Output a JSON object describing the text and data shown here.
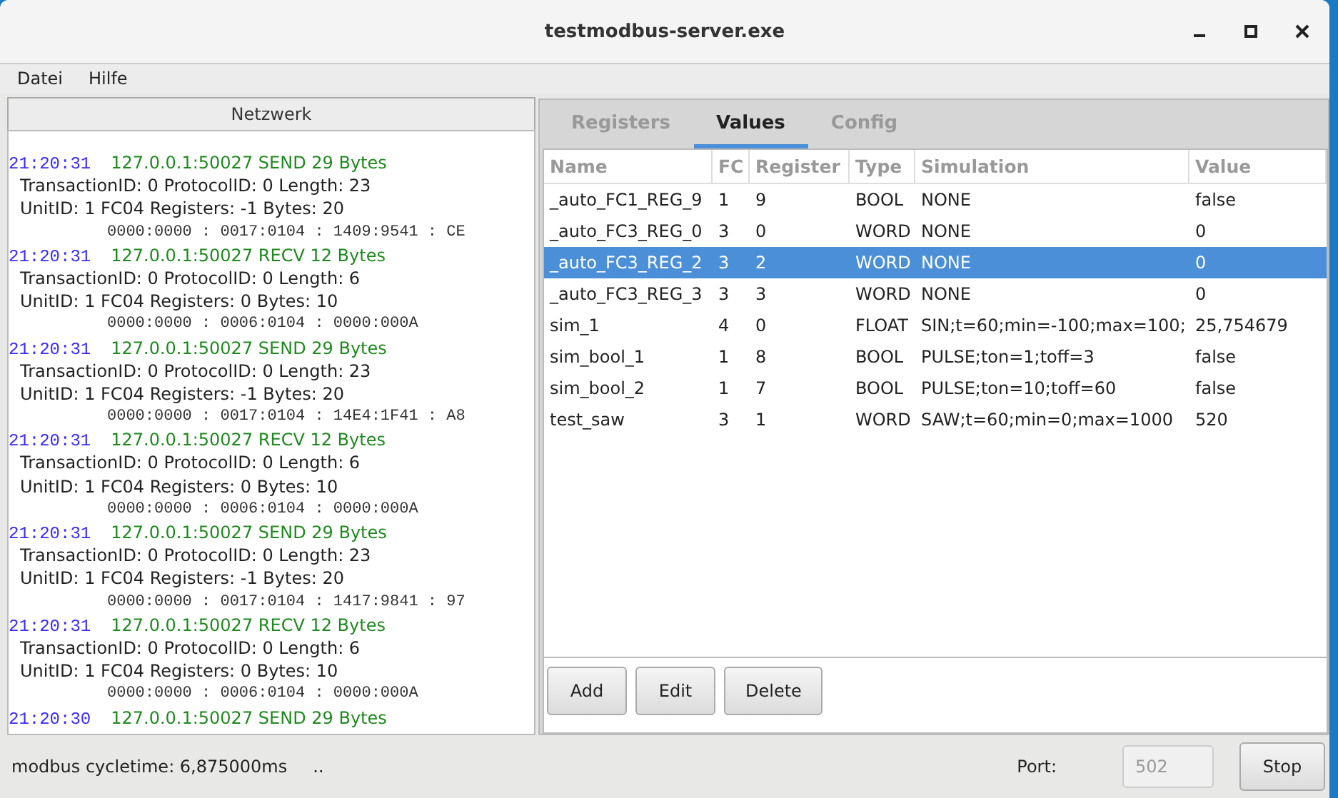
{
  "window": {
    "title": "testmodbus-server.exe"
  },
  "menu": [
    "Datei",
    "Hilfe"
  ],
  "network": {
    "title": "Netzwerk",
    "entries": [
      {
        "time": "21:20:31",
        "header": "127.0.0.1:50027 SEND 29 Bytes",
        "details": [
          "TransactionID: 0  ProtocolID: 0  Length: 23",
          "UnitID: 1  FC04 Registers: -1 Bytes: 20"
        ],
        "hex": "0000:0000 : 0017:0104 : 1409:9541 : CE"
      },
      {
        "time": "21:20:31",
        "header": "127.0.0.1:50027 RECV 12 Bytes",
        "details": [
          "TransactionID: 0  ProtocolID: 0  Length: 6",
          "UnitID: 1  FC04 Registers: 0 Bytes: 10"
        ],
        "hex": "0000:0000 : 0006:0104 : 0000:000A"
      },
      {
        "time": "21:20:31",
        "header": "127.0.0.1:50027 SEND 29 Bytes",
        "details": [
          "TransactionID: 0  ProtocolID: 0  Length: 23",
          "UnitID: 1  FC04 Registers: -1 Bytes: 20"
        ],
        "hex": "0000:0000 : 0017:0104 : 14E4:1F41 : A8"
      },
      {
        "time": "21:20:31",
        "header": "127.0.0.1:50027 RECV 12 Bytes",
        "details": [
          "TransactionID: 0  ProtocolID: 0  Length: 6",
          "UnitID: 1  FC04 Registers: 0 Bytes: 10"
        ],
        "hex": "0000:0000 : 0006:0104 : 0000:000A"
      },
      {
        "time": "21:20:31",
        "header": "127.0.0.1:50027 SEND 29 Bytes",
        "details": [
          "TransactionID: 0  ProtocolID: 0  Length: 23",
          "UnitID: 1  FC04 Registers: -1 Bytes: 20"
        ],
        "hex": "0000:0000 : 0017:0104 : 1417:9841 : 97"
      },
      {
        "time": "21:20:31",
        "header": "127.0.0.1:50027 RECV 12 Bytes",
        "details": [
          "TransactionID: 0  ProtocolID: 0  Length: 6",
          "UnitID: 1  FC04 Registers: 0 Bytes: 10"
        ],
        "hex": "0000:0000 : 0006:0104 : 0000:000A"
      },
      {
        "time": "21:20:30",
        "header": "127.0.0.1:50027 SEND 29 Bytes"
      }
    ]
  },
  "tabs": [
    {
      "label": "Registers",
      "selected": false
    },
    {
      "label": "Values",
      "selected": true
    },
    {
      "label": "Config",
      "selected": false
    }
  ],
  "table": {
    "columns": [
      "Name",
      "FC",
      "Register",
      "Type",
      "Simulation",
      "Value"
    ],
    "rows": [
      {
        "cells": [
          "_auto_FC1_REG_9",
          "1",
          "9",
          "BOOL",
          "NONE",
          "false"
        ],
        "selected": false
      },
      {
        "cells": [
          "_auto_FC3_REG_0",
          "3",
          "0",
          "WORD",
          "NONE",
          "0"
        ],
        "selected": false
      },
      {
        "cells": [
          "_auto_FC3_REG_2",
          "3",
          "2",
          "WORD",
          "NONE",
          "0"
        ],
        "selected": true
      },
      {
        "cells": [
          "_auto_FC3_REG_3",
          "3",
          "3",
          "WORD",
          "NONE",
          "0"
        ],
        "selected": false
      },
      {
        "cells": [
          "sim_1",
          "4",
          "0",
          "FLOAT",
          "SIN;t=60;min=-100;max=100;",
          "25,754679"
        ],
        "selected": false
      },
      {
        "cells": [
          "sim_bool_1",
          "1",
          "8",
          "BOOL",
          "PULSE;ton=1;toff=3",
          "false"
        ],
        "selected": false
      },
      {
        "cells": [
          "sim_bool_2",
          "1",
          "7",
          "BOOL",
          "PULSE;ton=10;toff=60",
          "false"
        ],
        "selected": false
      },
      {
        "cells": [
          "test_saw",
          "3",
          "1",
          "WORD",
          "SAW;t=60;min=0;max=1000",
          "520"
        ],
        "selected": false
      }
    ]
  },
  "buttons": [
    "Add",
    "Edit",
    "Delete"
  ],
  "status_bar": {
    "cycletime": "modbus cycletime: 6,875000ms",
    "dots": "..",
    "port_label": "Port:",
    "port_placeholder": "502",
    "stop": "Stop"
  }
}
